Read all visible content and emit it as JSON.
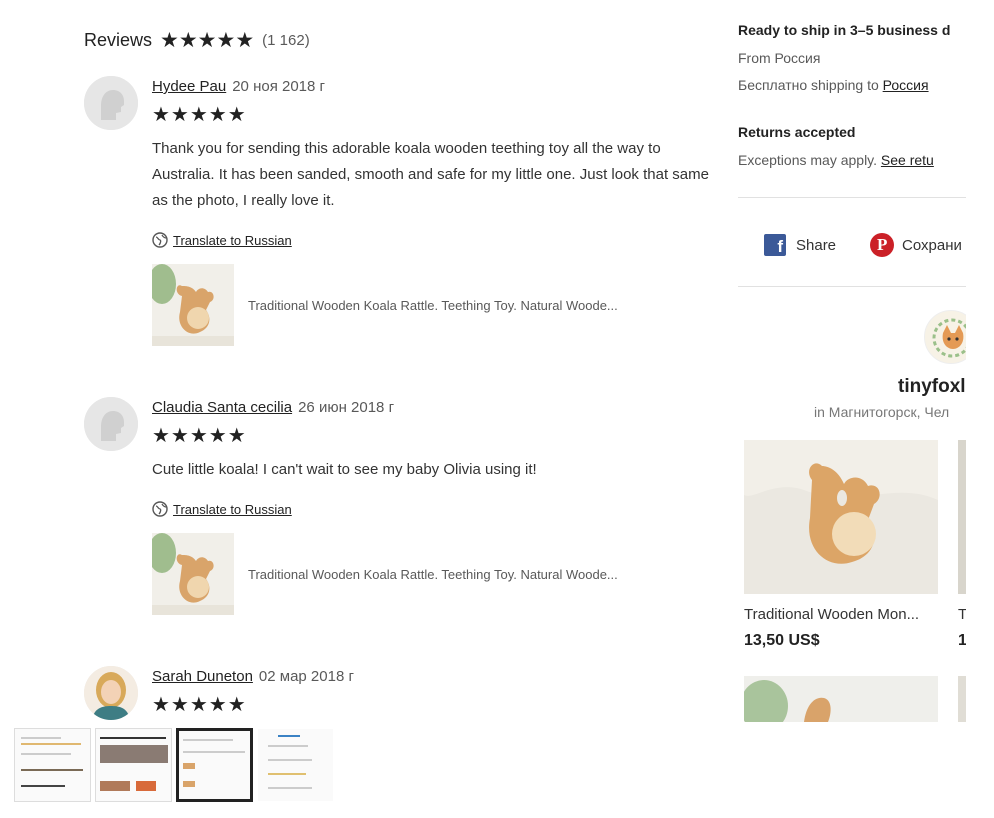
{
  "reviews": {
    "title": "Reviews",
    "stars": "★★★★★",
    "count": "(1 162)",
    "items": [
      {
        "name": "Hydee Pau",
        "date": "20 ноя 2018 г",
        "stars": "★★★★★",
        "text": "Thank you for sending this adorable koala wooden teething toy all the way to Australia. It has been sanded, smooth and safe for my little one. Just look that same as the photo, I really love it.",
        "translate": "Translate to Russian",
        "item_title": "Traditional Wooden Koala Rattle. Teething Toy. Natural Woode..."
      },
      {
        "name": "Claudia Santa cecilia",
        "date": "26 июн 2018 г",
        "stars": "★★★★★",
        "text": "Cute little koala! I can't wait to see my baby Olivia using it!",
        "translate": "Translate to Russian",
        "item_title": "Traditional Wooden Koala Rattle. Teething Toy. Natural Woode..."
      },
      {
        "name": "Sarah Duneton",
        "date": "02 мар 2018 г",
        "stars": "★★★★★"
      }
    ]
  },
  "shipping": {
    "title": "Ready to ship in 3–5 business d",
    "from": "From Россия",
    "free_prefix": "Бесплатно shipping to ",
    "free_link": "Россия"
  },
  "returns": {
    "title": "Returns accepted",
    "text_prefix": "Exceptions may apply. ",
    "text_link": "See retu"
  },
  "share": {
    "facebook_label": "Share",
    "pinterest_label": "Сохрани"
  },
  "shop": {
    "name": "tinyfoxl",
    "location": "in Магнитогорск, Чел",
    "listings": [
      {
        "title": "Traditional Wooden Mon...",
        "price": "13,50 US$"
      },
      {
        "title": "T",
        "price": "1"
      }
    ]
  },
  "colors": {
    "facebook": "#3b5998",
    "pinterest": "#cb2027",
    "text": "#222222",
    "muted": "#595959"
  }
}
